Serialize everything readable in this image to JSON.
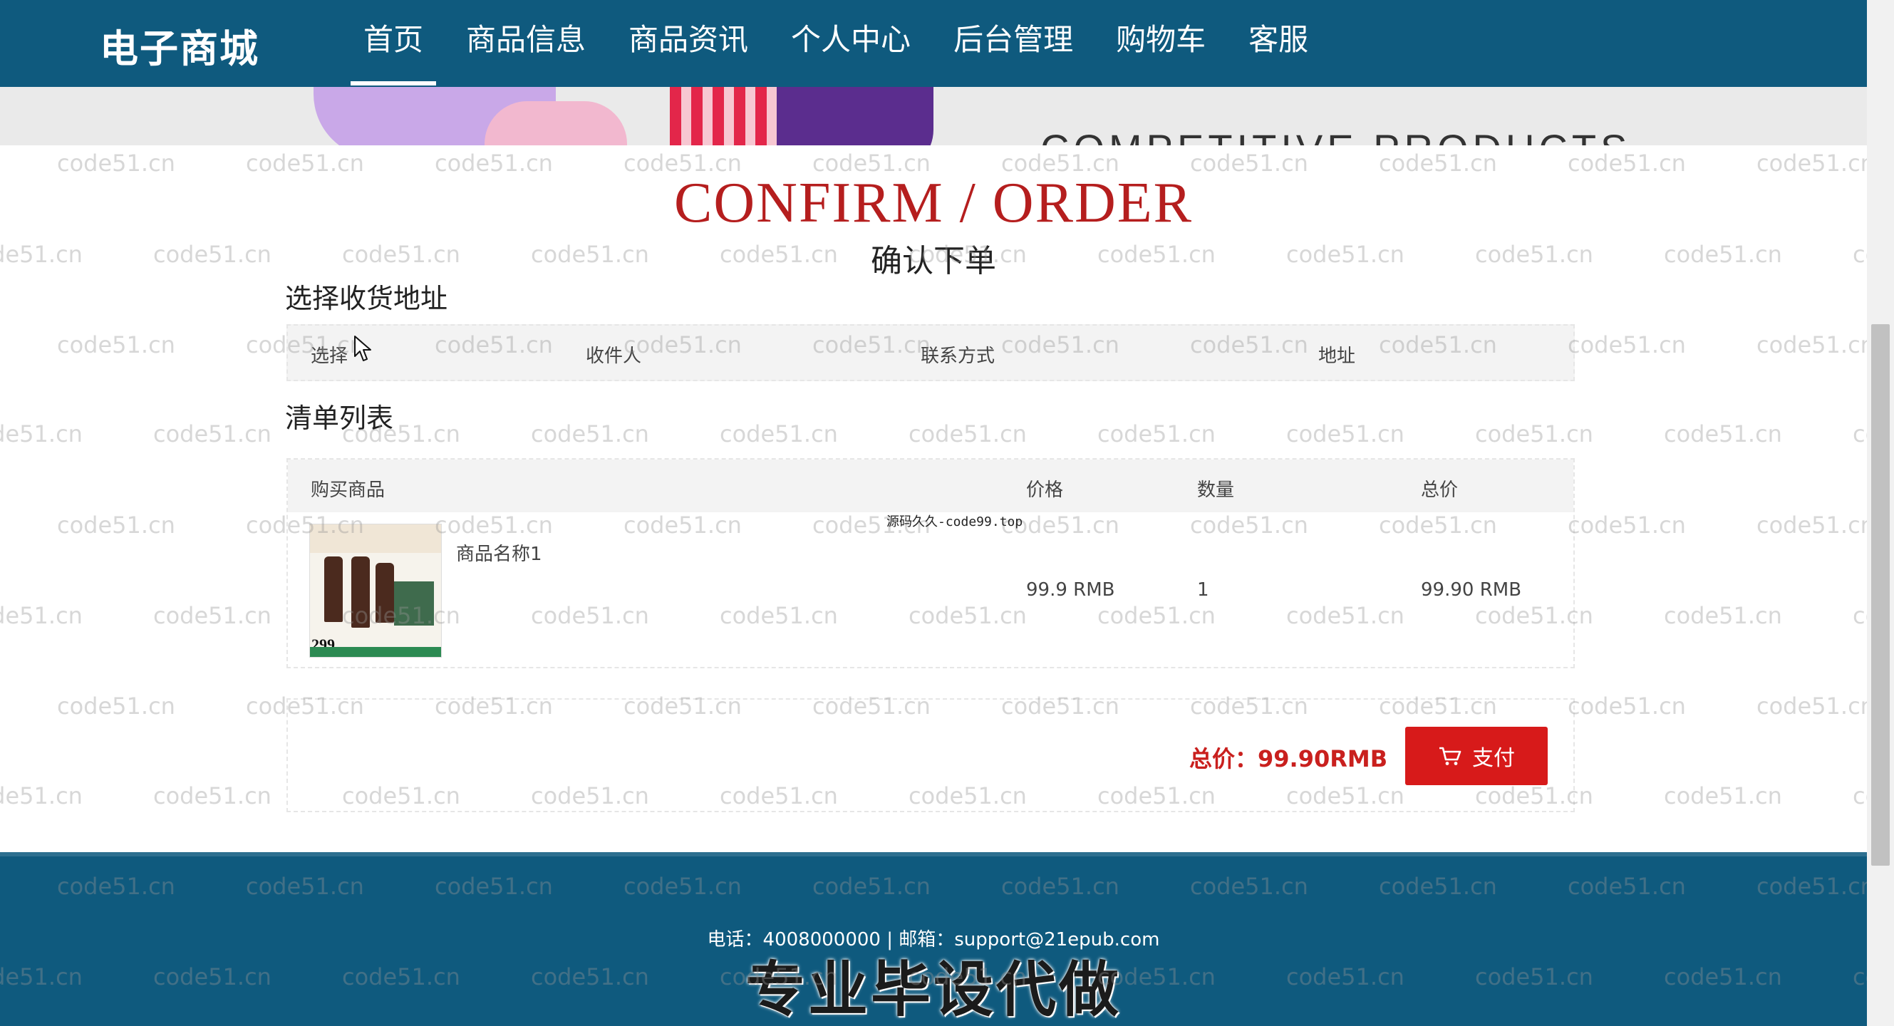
{
  "header": {
    "brand": "电子商城",
    "nav": [
      {
        "label": "首页",
        "active": true
      },
      {
        "label": "商品信息"
      },
      {
        "label": "商品资讯"
      },
      {
        "label": "个人中心"
      },
      {
        "label": "后台管理"
      },
      {
        "label": "购物车"
      },
      {
        "label": "客服"
      }
    ]
  },
  "banner": {
    "text": "COMPETITIVE PRODUCTS"
  },
  "page": {
    "title_en": "CONFIRM / ORDER",
    "title_cn": "确认下单"
  },
  "address": {
    "section_title": "选择收货地址",
    "headers": [
      "选择",
      "收件人",
      "联系方式",
      "地址"
    ]
  },
  "order": {
    "section_title": "清单列表",
    "headers": [
      "购买商品",
      "价格",
      "数量",
      "总价"
    ],
    "items": [
      {
        "name": "商品名称1",
        "price": "99.9 RMB",
        "quantity": "1",
        "total": "99.90 RMB",
        "image_badge": "299"
      }
    ]
  },
  "summary": {
    "total": "总价：99.90RMB",
    "pay_label": "支付"
  },
  "footer": {
    "contact": "电话：4008000000 | 邮箱：support@21epub.com",
    "overlay": "专业毕设代做"
  },
  "overlay_watermark": "源码久久-code99.top",
  "watermark": "code51.cn",
  "colors": {
    "header_bg": "#0f5a7e",
    "accent_red": "#b51e1e",
    "pay_button": "#d71a1a"
  }
}
